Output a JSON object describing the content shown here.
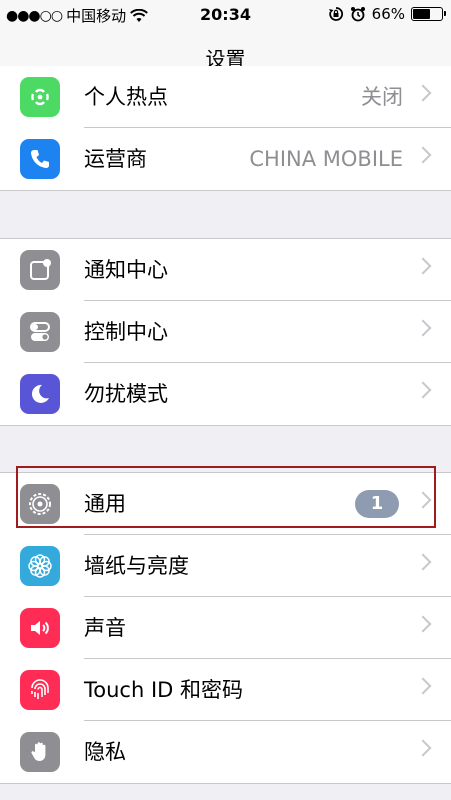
{
  "status_bar": {
    "signal": "●●●○○",
    "carrier": "中国移动",
    "time": "20:34",
    "battery": "66%",
    "battery_level": 0.66
  },
  "nav": {
    "title": "设置"
  },
  "groups": [
    {
      "items": [
        {
          "label": "个人热点",
          "value": "关闭",
          "icon": "hotspot-icon",
          "color": "#4cd964"
        },
        {
          "label": "运营商",
          "value": "CHINA MOBILE",
          "icon": "phone-icon",
          "color": "#1c83f0"
        }
      ]
    },
    {
      "items": [
        {
          "label": "通知中心",
          "icon": "notification-center-icon",
          "color": "#8e8e93"
        },
        {
          "label": "控制中心",
          "icon": "control-center-icon",
          "color": "#8e8e93"
        },
        {
          "label": "勿扰模式",
          "icon": "moon-icon",
          "color": "#5856d6"
        }
      ]
    },
    {
      "items": [
        {
          "label": "通用",
          "badge": "1",
          "icon": "gear-icon",
          "color": "#8e8e93"
        },
        {
          "label": "墙纸与亮度",
          "icon": "wallpaper-icon",
          "color": "#34aadc"
        },
        {
          "label": "声音",
          "icon": "speaker-icon",
          "color": "#ff2d55"
        },
        {
          "label": "Touch ID 和密码",
          "icon": "fingerprint-icon",
          "color": "#ff2d55"
        },
        {
          "label": "隐私",
          "icon": "hand-icon",
          "color": "#8e8e93"
        }
      ]
    }
  ]
}
